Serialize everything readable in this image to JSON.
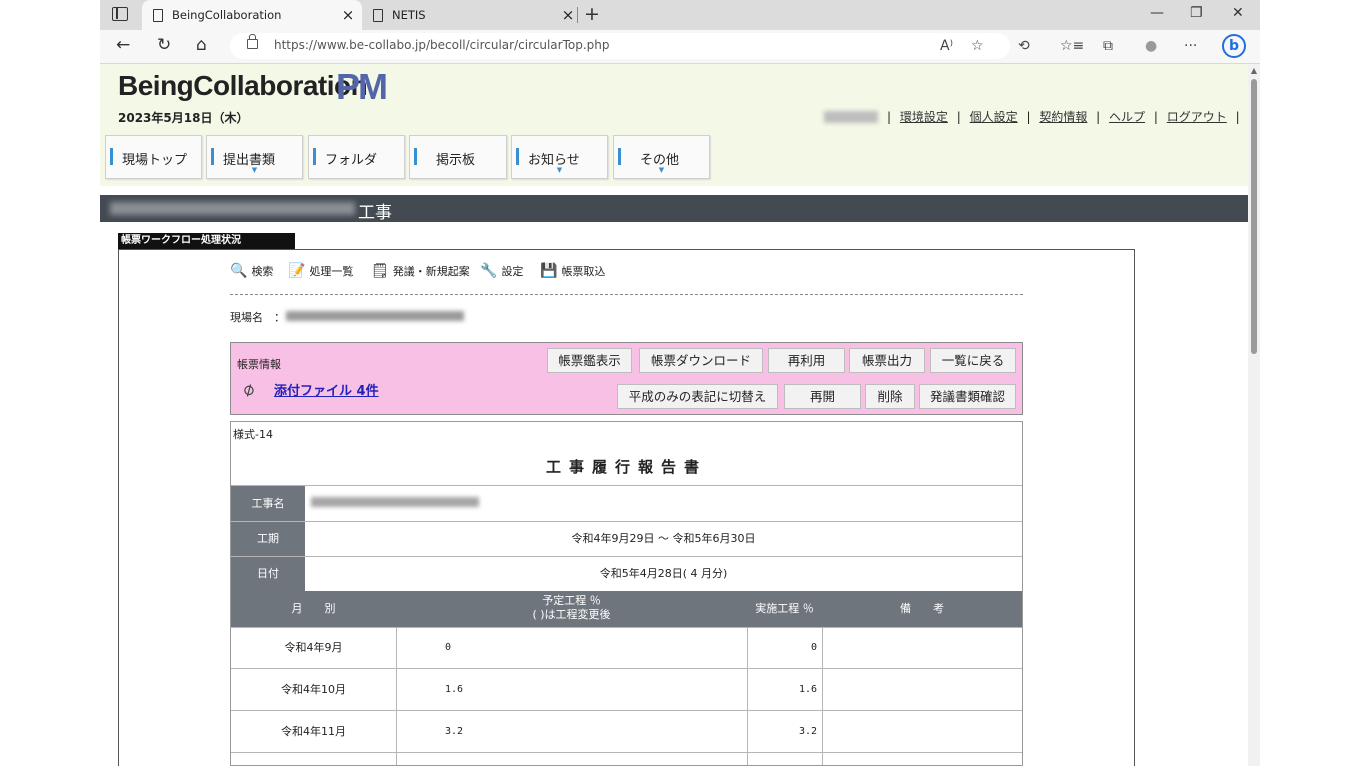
{
  "browser": {
    "tabs": [
      {
        "title": "BeingCollaboration",
        "active": true
      },
      {
        "title": "NETIS",
        "active": false
      }
    ],
    "url": "https://www.be-collabo.jp/becoll/circular/circularTop.php",
    "window_controls": {
      "minimize": "—",
      "restore": "❐",
      "close": "✕"
    },
    "nav_icons": {
      "back": "←",
      "reload": "↻",
      "home": "⌂"
    },
    "toolbar_icons": [
      "A⁾",
      "☆",
      "⟲",
      "☆≡",
      "⧉",
      "●",
      "···"
    ],
    "bing_label": "b"
  },
  "site": {
    "logo_text": "BeingCollaboration",
    "logo_pm": "PM",
    "date": "2023年5月18日（木）",
    "header_links": [
      "環境設定",
      "個人設定",
      "契約情報",
      "ヘルプ",
      "ログアウト"
    ],
    "link_separator": "|",
    "nav": [
      {
        "label": "現場トップ",
        "has_menu": false
      },
      {
        "label": "提出書類",
        "has_menu": true
      },
      {
        "label": "フォルダ",
        "has_menu": false
      },
      {
        "label": "掲示板",
        "has_menu": false
      },
      {
        "label": "お知らせ",
        "has_menu": true
      },
      {
        "label": "その他",
        "has_menu": true
      }
    ],
    "nav_caret": "▼",
    "project_title_suffix": "工事",
    "accent_color": "#3a8fd0",
    "pm_color": "#5566a8"
  },
  "workflow": {
    "section_label": "帳票ワークフロー処理状況",
    "tools": [
      {
        "label": "検索",
        "icon": "🔍"
      },
      {
        "label": "処理一覧",
        "icon": "📝"
      },
      {
        "label": "発議・新規起案",
        "icon": "🗒"
      },
      {
        "label": "設定",
        "icon": "🔧"
      },
      {
        "label": "帳票取込",
        "icon": "💾"
      }
    ],
    "genba_label": "現場名　：",
    "info": {
      "title": "帳票情報",
      "attachments_link": "添付ファイル 4件",
      "buttons_row1": [
        "帳票鑑表示",
        "帳票ダウンロード",
        "再利用",
        "帳票出力",
        "一覧に戻る"
      ],
      "buttons_row2": [
        "平成のみの表記に切替え",
        "再開",
        "削除",
        "発議書類確認"
      ],
      "bg_color": "#f8c0e4"
    }
  },
  "report": {
    "form_no": "様式-14",
    "title": "工事履行報告書",
    "label_name": "工事名",
    "label_period": "工期",
    "period_value": "令和4年9月29日 ～ 令和5年6月30日",
    "label_date": "日付",
    "date_value": "令和5年4月28日( 4 月分)",
    "col_month": "月　　別",
    "col_planned_1": "予定工程 ％",
    "col_planned_2": "( )は工程変更後",
    "col_actual": "実施工程 ％",
    "col_remarks": "備　　考",
    "rows": [
      {
        "month": "令和4年9月",
        "planned": "0",
        "actual": "0",
        "remarks": ""
      },
      {
        "month": "令和4年10月",
        "planned": "1.6",
        "actual": "1.6",
        "remarks": ""
      },
      {
        "month": "令和4年11月",
        "planned": "3.2",
        "actual": "3.2",
        "remarks": ""
      }
    ]
  }
}
